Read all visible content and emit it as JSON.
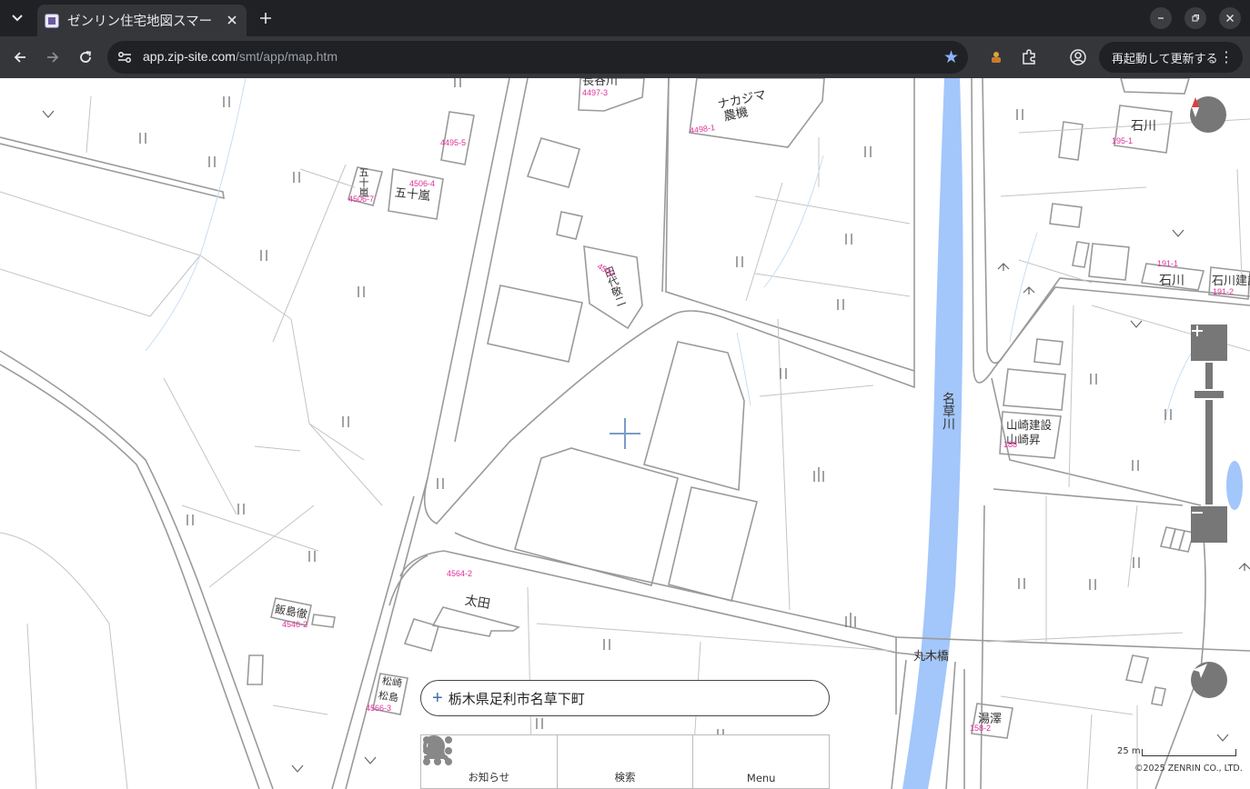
{
  "browser": {
    "tab_title": "ゼンリン住宅地図スマー",
    "url_host": "app.zip-site.com",
    "url_path": "/smt/app/map.htm",
    "update_button": "再起動して更新する"
  },
  "map": {
    "address": "栃木県足利市名草下町",
    "river_label": "名草川",
    "bridge_label": "丸木橋",
    "scale_label": "25 m",
    "copyright": "©2025 ZENRIN CO., LTD.",
    "buildings": {
      "nakajima_1": "ナカジマ",
      "nakajima_2": "農機",
      "igarashi": "五十嵐",
      "igarashi_v": "五十嵐",
      "ishikawa_top": "石川",
      "ishikawa_mid": "石川",
      "ishikawa_kensetsu": "石川建設",
      "tashiro": "田代敬二",
      "yamazaki_1": "山崎建設",
      "yamazaki_2": "山崎昇",
      "ota": "太田",
      "iijima": "飯島徹",
      "matsuzaki_1": "松崎",
      "matsuzaki_2": "松島",
      "yuzawa": "湯澤",
      "top_partial": "長谷川"
    },
    "lots": {
      "l1": "4497-3",
      "l2": "4498-1",
      "l3": "4495-5",
      "l4": "4506-4",
      "l5": "4506-7",
      "l6": "4503",
      "l7": "195-1",
      "l8": "191-1",
      "l9": "191-2",
      "l10": "188",
      "l11": "4564-2",
      "l12": "4546-2",
      "l13": "4566-3",
      "l14": "158-2"
    }
  },
  "nav": {
    "notice": "お知らせ",
    "search": "検索",
    "menu": "Menu"
  },
  "colors": {
    "river": "#a3c6fb",
    "line": "#8c8c8c",
    "thin_line": "#b5b5b5",
    "lot_text": "#e0309a",
    "control_grey": "#777777"
  }
}
